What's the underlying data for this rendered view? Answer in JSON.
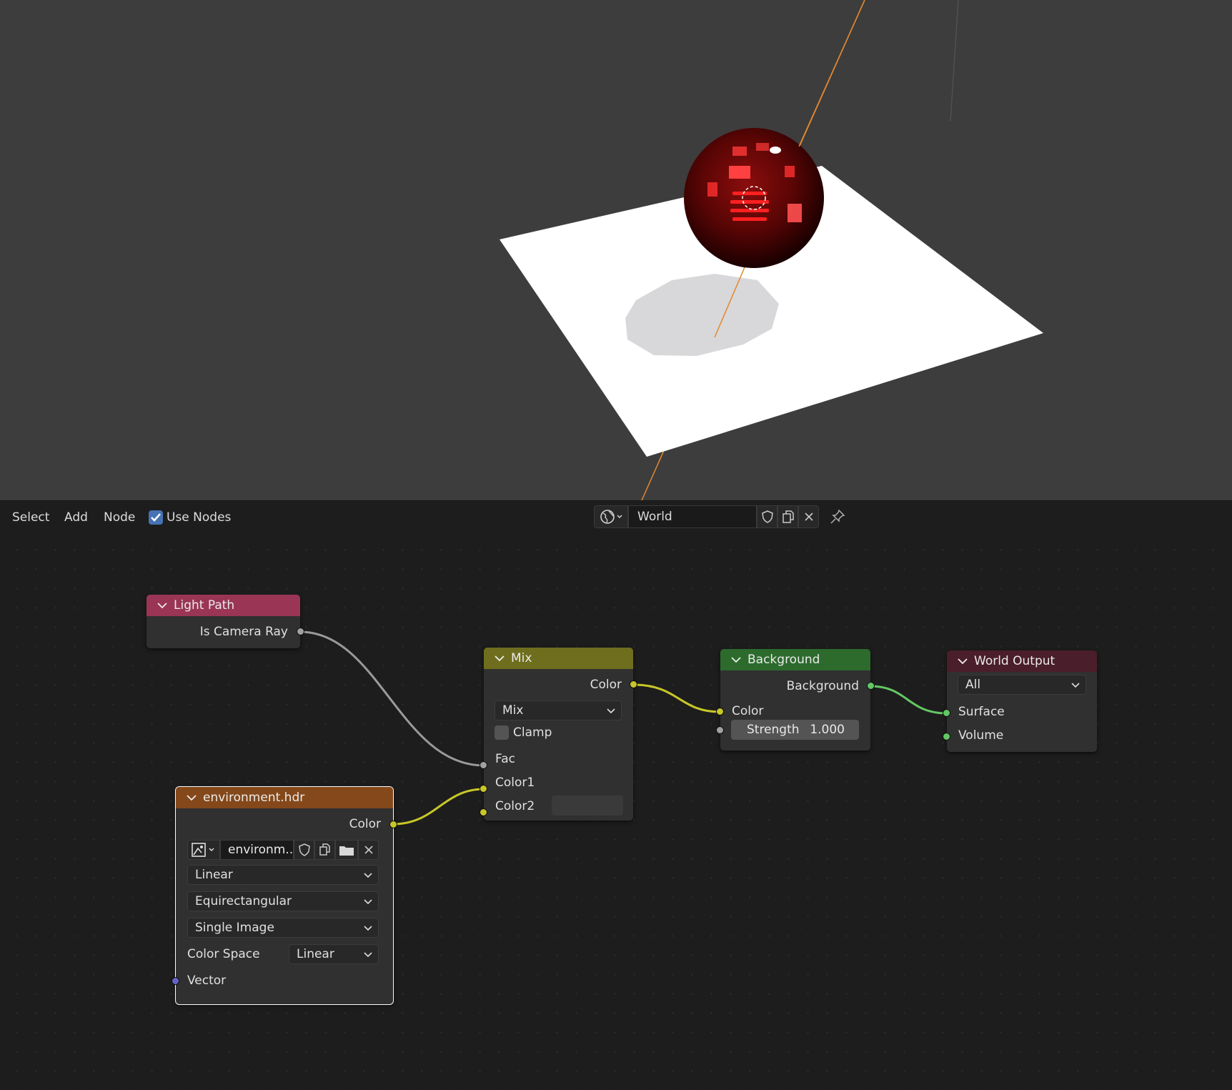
{
  "header": {
    "menu": [
      "Select",
      "Add",
      "Node"
    ],
    "use_nodes_label": "Use Nodes",
    "use_nodes_checked": true,
    "world_name": "World"
  },
  "nodes": {
    "light_path": {
      "title": "Light Path",
      "output": "Is Camera Ray",
      "color": "#9a3556"
    },
    "mix": {
      "title": "Mix",
      "output": "Color",
      "blend_mode": "Mix",
      "clamp_label": "Clamp",
      "clamp_checked": false,
      "inputs": [
        "Fac",
        "Color1",
        "Color2"
      ],
      "color": "#6e6e1e"
    },
    "background": {
      "title": "Background",
      "output": "Background",
      "input_color": "Color",
      "strength_label": "Strength",
      "strength_value": "1.000",
      "color": "#2c6b2c"
    },
    "world_output": {
      "title": "World Output",
      "target": "All",
      "inputs": [
        "Surface",
        "Volume"
      ],
      "color": "#4a1e2a"
    },
    "environment": {
      "title": "environment.hdr",
      "output": "Color",
      "image_name": "environm...",
      "interpolation": "Linear",
      "projection": "Equirectangular",
      "source": "Single Image",
      "color_space_label": "Color Space",
      "color_space": "Linear",
      "input_vector": "Vector",
      "color": "#84481a"
    }
  },
  "socket_colors": {
    "color": "#c7c729",
    "float": "#a1a1a1",
    "shader": "#63c763",
    "vector": "#6363c7"
  }
}
